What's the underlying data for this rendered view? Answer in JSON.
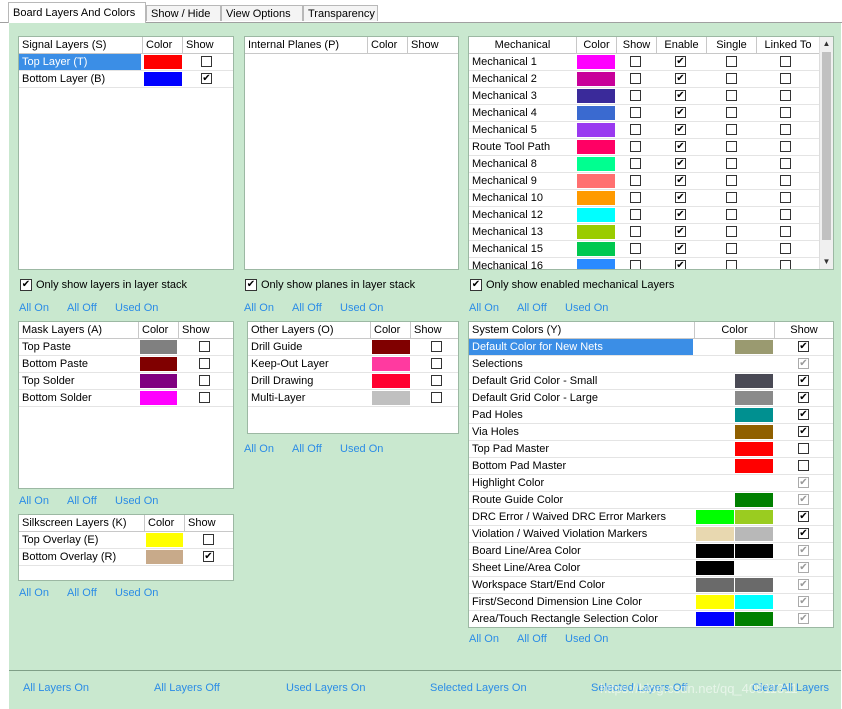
{
  "tabs": [
    "Board Layers And Colors",
    "Show / Hide",
    "View Options",
    "Transparency"
  ],
  "signal": {
    "headers": [
      "Signal Layers (S)",
      "Color",
      "Show"
    ],
    "rows": [
      {
        "name": "Top Layer (T)",
        "color": "#ff0000",
        "show": false,
        "selected": true
      },
      {
        "name": "Bottom Layer (B)",
        "color": "#0000ff",
        "show": true,
        "selected": false
      }
    ],
    "option": "Only show layers in layer stack",
    "option_checked": true
  },
  "planes": {
    "headers": [
      "Internal Planes (P)",
      "Color",
      "Show"
    ],
    "option": "Only show planes in layer stack",
    "option_checked": true
  },
  "mech": {
    "headers": [
      "Mechanical",
      "Color",
      "Show",
      "Enable",
      "Single",
      "Linked To"
    ],
    "rows": [
      {
        "name": "Mechanical 1",
        "color": "#ff00ff",
        "show": false,
        "enable": true
      },
      {
        "name": "Mechanical 2",
        "color": "#c8009a",
        "show": false,
        "enable": true
      },
      {
        "name": "Mechanical 3",
        "color": "#3a2a9a",
        "show": false,
        "enable": true
      },
      {
        "name": "Mechanical 4",
        "color": "#3a6ad0",
        "show": false,
        "enable": true
      },
      {
        "name": "Mechanical 5",
        "color": "#9a3af0",
        "show": false,
        "enable": true
      },
      {
        "name": "Route Tool Path",
        "color": "#ff0064",
        "show": false,
        "enable": true
      },
      {
        "name": "Mechanical 8",
        "color": "#00ff90",
        "show": false,
        "enable": true
      },
      {
        "name": "Mechanical 9",
        "color": "#ff7070",
        "show": false,
        "enable": true
      },
      {
        "name": "Mechanical 10",
        "color": "#ff9a00",
        "show": false,
        "enable": true
      },
      {
        "name": "Mechanical 12",
        "color": "#00ffff",
        "show": false,
        "enable": true
      },
      {
        "name": "Mechanical 13",
        "color": "#9acc00",
        "show": false,
        "enable": true
      },
      {
        "name": "Mechanical 15",
        "color": "#00c850",
        "show": false,
        "enable": true
      },
      {
        "name": "Mechanical 16",
        "color": "#2a8aff",
        "show": false,
        "enable": true
      }
    ],
    "option": "Only show enabled mechanical Layers",
    "option_checked": true
  },
  "mask": {
    "headers": [
      "Mask Layers (A)",
      "Color",
      "Show"
    ],
    "rows": [
      {
        "name": "Top Paste",
        "color": "#808080",
        "show": false
      },
      {
        "name": "Bottom Paste",
        "color": "#800000",
        "show": false
      },
      {
        "name": "Top Solder",
        "color": "#800080",
        "show": false
      },
      {
        "name": "Bottom Solder",
        "color": "#ff00ff",
        "show": false
      }
    ]
  },
  "other": {
    "headers": [
      "Other Layers (O)",
      "Color",
      "Show"
    ],
    "rows": [
      {
        "name": "Drill Guide",
        "color": "#800000",
        "show": false
      },
      {
        "name": "Keep-Out Layer",
        "color": "#ff3aa0",
        "show": false
      },
      {
        "name": "Drill Drawing",
        "color": "#ff0030",
        "show": false
      },
      {
        "name": "Multi-Layer",
        "color": "#c0c0c0",
        "show": false
      }
    ]
  },
  "silk": {
    "headers": [
      "Silkscreen Layers (K)",
      "Color",
      "Show"
    ],
    "rows": [
      {
        "name": "Top Overlay (E)",
        "color": "#ffff00",
        "show": false
      },
      {
        "name": "Bottom Overlay (R)",
        "color": "#c8aa8a",
        "show": true
      }
    ]
  },
  "system": {
    "headers": [
      "System Colors (Y)",
      "Color",
      "Show"
    ],
    "rows": [
      {
        "name": "Default Color for New Nets",
        "c1": "",
        "c2": "#9a9a70",
        "show": true,
        "enabled": true,
        "selected": true
      },
      {
        "name": "Selections",
        "c1": "",
        "c2": "#ffffff",
        "show": true,
        "enabled": false,
        "selected": false
      },
      {
        "name": "Default Grid Color - Small",
        "c1": "",
        "c2": "#4a4a55",
        "show": true,
        "enabled": true,
        "selected": false
      },
      {
        "name": "Default Grid Color - Large",
        "c1": "",
        "c2": "#8a8a8a",
        "show": true,
        "enabled": true,
        "selected": false
      },
      {
        "name": "Pad Holes",
        "c1": "",
        "c2": "#009090",
        "show": true,
        "enabled": true,
        "selected": false
      },
      {
        "name": "Via Holes",
        "c1": "",
        "c2": "#906000",
        "show": true,
        "enabled": true,
        "selected": false
      },
      {
        "name": "Top Pad Master",
        "c1": "",
        "c2": "#ff0000",
        "show": false,
        "enabled": true,
        "selected": false
      },
      {
        "name": "Bottom Pad Master",
        "c1": "",
        "c2": "#ff0000",
        "show": false,
        "enabled": true,
        "selected": false
      },
      {
        "name": "Highlight Color",
        "c1": "",
        "c2": "#ffffff",
        "show": true,
        "enabled": false,
        "selected": false
      },
      {
        "name": "Route Guide Color",
        "c1": "",
        "c2": "#008000",
        "show": true,
        "enabled": false,
        "selected": false
      },
      {
        "name": "DRC Error / Waived DRC Error Markers",
        "c1": "#00ff00",
        "c2": "#9acc20",
        "show": true,
        "enabled": true,
        "selected": false
      },
      {
        "name": "Violation / Waived Violation Markers",
        "c1": "#e8d8b0",
        "c2": "#b8b8b8",
        "show": true,
        "enabled": true,
        "selected": false
      },
      {
        "name": "Board Line/Area Color",
        "c1": "#000000",
        "c2": "#000000",
        "show": true,
        "enabled": false,
        "selected": false
      },
      {
        "name": "Sheet Line/Area Color",
        "c1": "#000000",
        "c2": "#ffffff",
        "show": true,
        "enabled": false,
        "selected": false
      },
      {
        "name": "Workspace Start/End Color",
        "c1": "#6a6a6a",
        "c2": "#6a6a6a",
        "show": true,
        "enabled": false,
        "selected": false
      },
      {
        "name": "First/Second Dimension Line Color",
        "c1": "#ffff00",
        "c2": "#00ffff",
        "show": true,
        "enabled": false,
        "selected": false
      },
      {
        "name": "Area/Touch Rectangle Selection Color",
        "c1": "#0000ff",
        "c2": "#008000",
        "show": true,
        "enabled": false,
        "selected": false
      }
    ]
  },
  "links": {
    "all_on": "All On",
    "all_off": "All Off",
    "used_on": "Used On"
  },
  "footer": {
    "all_layers_on": "All Layers On",
    "all_layers_off": "All Layers Off",
    "used_layers_on": "Used Layers On",
    "selected_layers_on": "Selected Layers On",
    "selected_layers_off": "Selected Layers Off",
    "clear_all_layers": "Clear All Layers"
  },
  "watermark": "https://blog.csdn.net/qq_40811311",
  "check_glyph": "✔"
}
